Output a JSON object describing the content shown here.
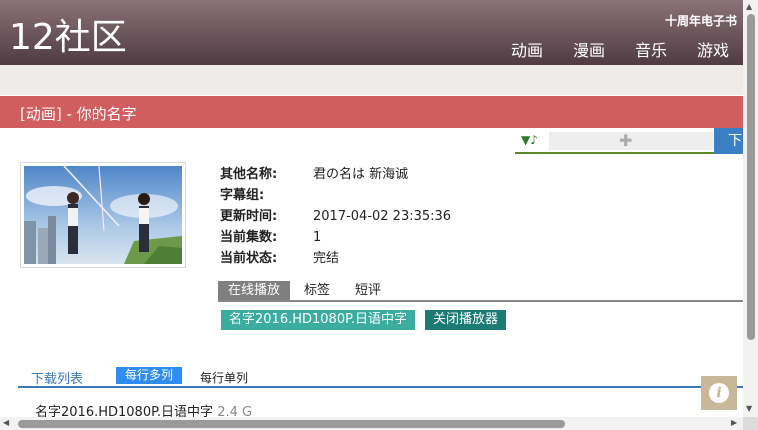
{
  "header": {
    "logo": "12社区",
    "tagline": "十周年电子书",
    "nav": [
      "动画",
      "漫画",
      "音乐",
      "游戏"
    ]
  },
  "page_title": "[动画] - 你的名字",
  "download_button_label": "下",
  "details": [
    {
      "label": "其他名称:",
      "value": "君の名は 新海诚"
    },
    {
      "label": "字幕组:",
      "value": ""
    },
    {
      "label": "更新时间:",
      "value": "2017-04-02 23:35:36"
    },
    {
      "label": "当前集数:",
      "value": "1"
    },
    {
      "label": "当前状态:",
      "value": "完结"
    }
  ],
  "tabs": [
    "在线播放",
    "标签",
    "短评"
  ],
  "play_button": "名字2016.HD1080P.日语中字",
  "close_player_button": "关闭播放器",
  "downloads": {
    "title": "下载列表",
    "multi_label": "每行多列",
    "single_label": "每行单列",
    "file_name": "名字2016.HD1080P.日语中字",
    "file_size": "2.4 G"
  },
  "icons": {
    "music": "music-note-icon",
    "plugin": "puzzle-icon",
    "info": "info-icon"
  },
  "colors": {
    "header": "#6a565c",
    "title_bar": "#d05e5e",
    "accent_green": "#3aaca0",
    "accent_blue": "#2e8cf0"
  }
}
